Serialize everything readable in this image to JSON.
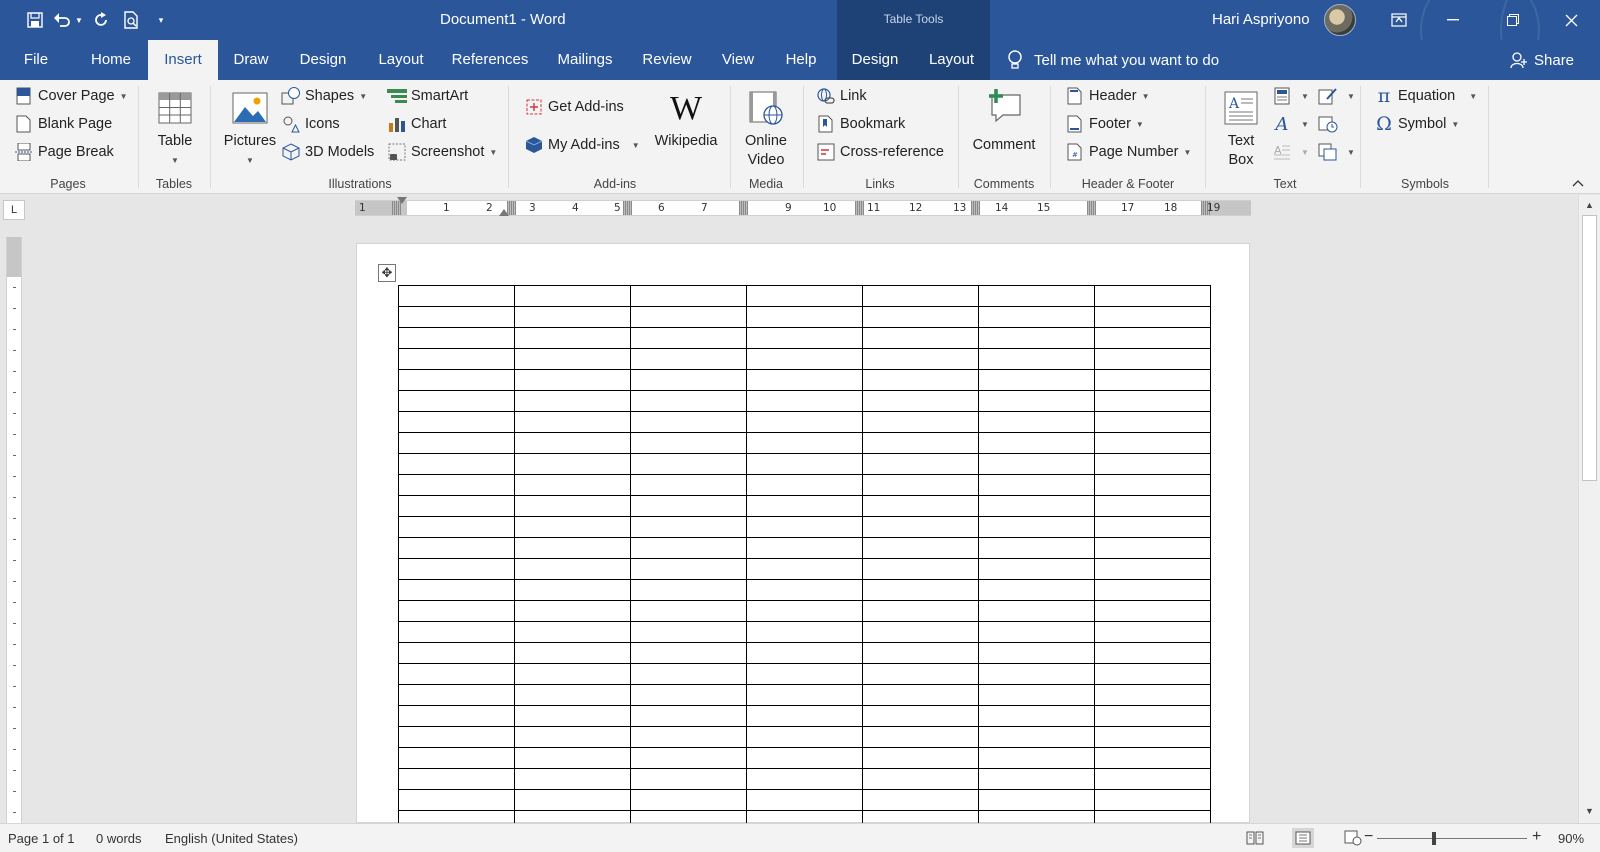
{
  "window": {
    "doc_title": "Document1  -  Word",
    "context_tools_label": "Table Tools",
    "user_name": "Hari Aspriyono"
  },
  "tabs": [
    {
      "label": "File",
      "active": false
    },
    {
      "label": "Home",
      "active": false
    },
    {
      "label": "Insert",
      "active": true
    },
    {
      "label": "Draw",
      "active": false
    },
    {
      "label": "Design",
      "active": false
    },
    {
      "label": "Layout",
      "active": false
    },
    {
      "label": "References",
      "active": false
    },
    {
      "label": "Mailings",
      "active": false
    },
    {
      "label": "Review",
      "active": false
    },
    {
      "label": "View",
      "active": false
    },
    {
      "label": "Help",
      "active": false
    },
    {
      "label": "Design",
      "active": false
    },
    {
      "label": "Layout",
      "active": false
    }
  ],
  "tell_me": "Tell me what you want to do",
  "share": "Share",
  "ribbon": {
    "pages": {
      "label": "Pages",
      "cover_page": "Cover Page",
      "blank_page": "Blank Page",
      "page_break": "Page Break"
    },
    "tables": {
      "label": "Tables",
      "table": "Table"
    },
    "illustrations": {
      "label": "Illustrations",
      "pictures": "Pictures",
      "shapes": "Shapes",
      "icons": "Icons",
      "models": "3D Models",
      "smartart": "SmartArt",
      "chart": "Chart",
      "screenshot": "Screenshot"
    },
    "addins": {
      "label": "Add-ins",
      "get_addins": "Get Add-ins",
      "my_addins": "My Add-ins",
      "wikipedia": "Wikipedia"
    },
    "media": {
      "label": "Media",
      "online_video_1": "Online",
      "online_video_2": "Video"
    },
    "links": {
      "label": "Links",
      "link": "Link",
      "bookmark": "Bookmark",
      "cross_reference": "Cross-reference"
    },
    "comments": {
      "label": "Comments",
      "comment": "Comment"
    },
    "header_footer": {
      "label": "Header & Footer",
      "header": "Header",
      "footer": "Footer",
      "page_number": "Page Number"
    },
    "text": {
      "label": "Text",
      "text_box_1": "Text",
      "text_box_2": "Box"
    },
    "symbols": {
      "label": "Symbols",
      "equation": "Equation",
      "symbol": "Symbol"
    }
  },
  "ruler": {
    "numbers": [
      "1",
      "1",
      "2",
      "3",
      "4",
      "5",
      "6",
      "7",
      "9",
      "10",
      "11",
      "12",
      "13",
      "14",
      "15",
      "17",
      "18",
      "19"
    ]
  },
  "document": {
    "table": {
      "rows": 26,
      "cols": 7
    }
  },
  "status": {
    "page": "Page 1 of 1",
    "words": "0 words",
    "language": "English (United States)",
    "zoom_minus": "−",
    "zoom_plus": "+",
    "zoom": "90%",
    "zoom_fraction": 0.38
  },
  "colors": {
    "accent": "#2b579a",
    "context_band": "#1e4176",
    "ribbon_bg": "#f3f3f3"
  }
}
